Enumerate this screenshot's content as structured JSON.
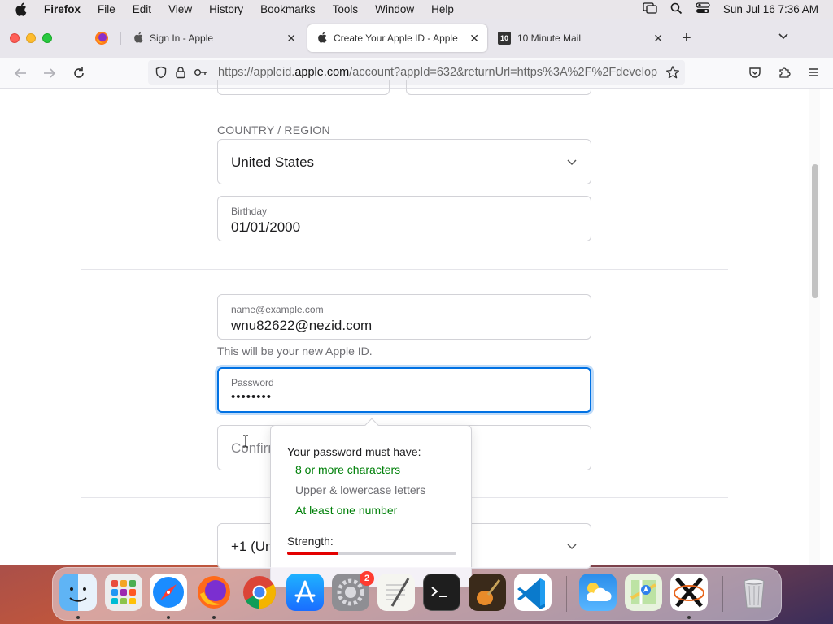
{
  "menubar": {
    "app_name": "Firefox",
    "items": [
      "File",
      "Edit",
      "View",
      "History",
      "Bookmarks",
      "Tools",
      "Window",
      "Help"
    ],
    "clock": "Sun Jul 16  7:36 AM"
  },
  "tabs": [
    {
      "title": "Sign In - Apple",
      "active": false
    },
    {
      "title": "Create Your Apple ID - Apple",
      "active": true
    },
    {
      "title": "10 Minute Mail",
      "active": false
    }
  ],
  "tab_icon_text": "10",
  "urlbar": {
    "prefix": "https://appleid.",
    "host": "apple.com",
    "rest": "/account?appId=632&returnUrl=https%3A%2F%2Fdevelop"
  },
  "form": {
    "country_section_label": "COUNTRY / REGION",
    "country_value": "United States",
    "birthday_label": "Birthday",
    "birthday_value": "01/01/2000",
    "email_label": "name@example.com",
    "email_value": "wnu82622@nezid.com",
    "email_hint": "This will be your new Apple ID.",
    "password_label": "Password",
    "password_value": "••••••••",
    "confirm_placeholder": "Confirm",
    "phone_value": "+1 (United States)"
  },
  "password_popover": {
    "title": "Your password must have:",
    "rules": [
      {
        "text": "8 or more characters",
        "met": true
      },
      {
        "text": "Upper & lowercase letters",
        "met": false
      },
      {
        "text": "At least one number",
        "met": true
      }
    ],
    "strength_label": "Strength:",
    "strength_fraction": 0.3
  },
  "dock": {
    "apps": [
      "finder",
      "launchpad",
      "safari",
      "firefox",
      "chrome",
      "app-store",
      "system-settings",
      "textedit",
      "terminal",
      "garageband",
      "vscode",
      "weather",
      "maps",
      "x11",
      "trash"
    ],
    "settings_badge": "2"
  },
  "colors": {
    "accent": "#0071e3",
    "rule_met": "#008009",
    "strength_bar": "#e30000"
  }
}
